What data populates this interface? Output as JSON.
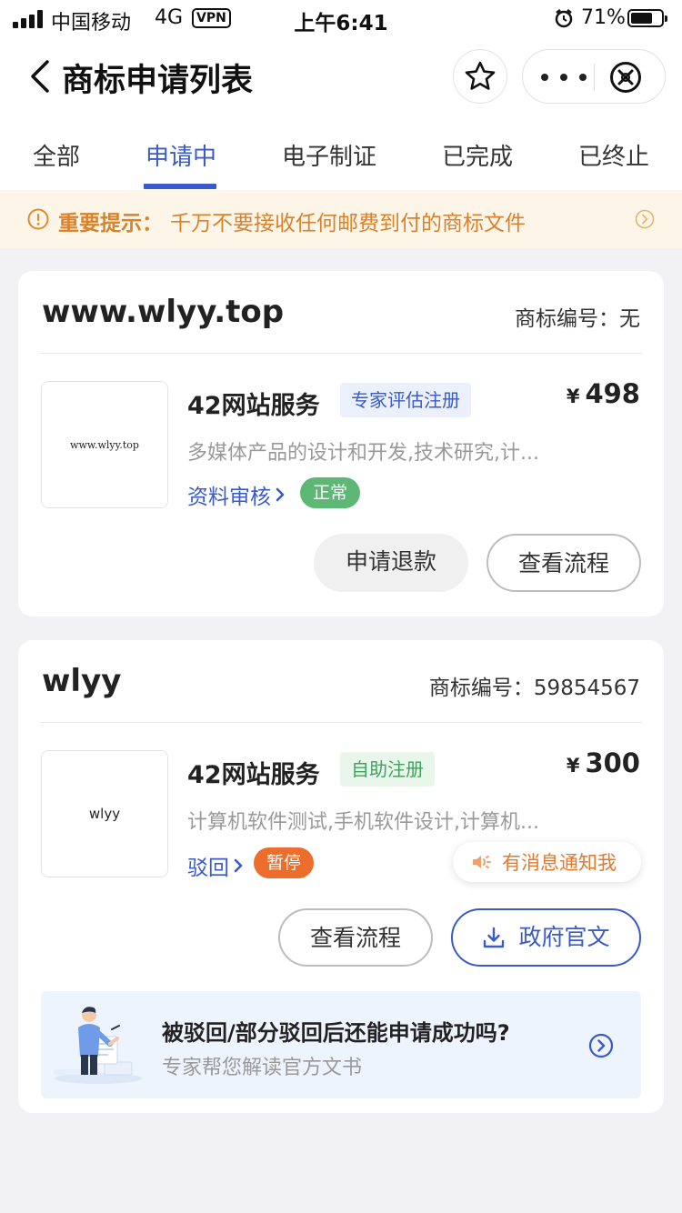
{
  "status_bar": {
    "carrier": "中国移动",
    "network": "4G",
    "vpn": "VPN",
    "time": "上午6:41",
    "battery_percent": "71%",
    "battery_level": 0.71
  },
  "nav": {
    "title": "商标申请列表"
  },
  "tabs": [
    {
      "label": "全部"
    },
    {
      "label": "申请中",
      "active": true
    },
    {
      "label": "电子制证"
    },
    {
      "label": "已完成"
    },
    {
      "label": "已终止"
    }
  ],
  "notice": {
    "label": "重要提示：",
    "text": "千万不要接收任何邮费到付的商标文件"
  },
  "cards": [
    {
      "name": "www.wlyy.top",
      "number_label": "商标编号：",
      "number": "无",
      "thumb_text": "www.wlyy.top",
      "service": "42网站服务",
      "tag": "专家评估注册",
      "price_symbol": "¥",
      "price": "498",
      "desc": "多媒体产品的设计和开发,技术研究,计...",
      "status_link": "资料审核",
      "status_pill": "正常",
      "buttons": [
        "申请退款",
        "查看流程"
      ]
    },
    {
      "name": "wlyy",
      "number_label": "商标编号：",
      "number": "59854567",
      "thumb_text": "wlyy",
      "service": "42网站服务",
      "tag": "自助注册",
      "price_symbol": "¥",
      "price": "300",
      "desc": "计算机软件测试,手机软件设计,计算机...",
      "status_link": "驳回",
      "status_pill": "暂停",
      "notify": "有消息通知我",
      "buttons": [
        "查看流程",
        "政府官文"
      ],
      "banner": {
        "question": "被驳回/部分驳回后还能申请成功吗?",
        "sub": "专家帮您解读官方文书"
      }
    }
  ],
  "colors": {
    "accent": "#3a5bc7",
    "warning": "#d9822b",
    "pill_normal": "#5cb874",
    "pill_paused": "#ec6d2c"
  }
}
